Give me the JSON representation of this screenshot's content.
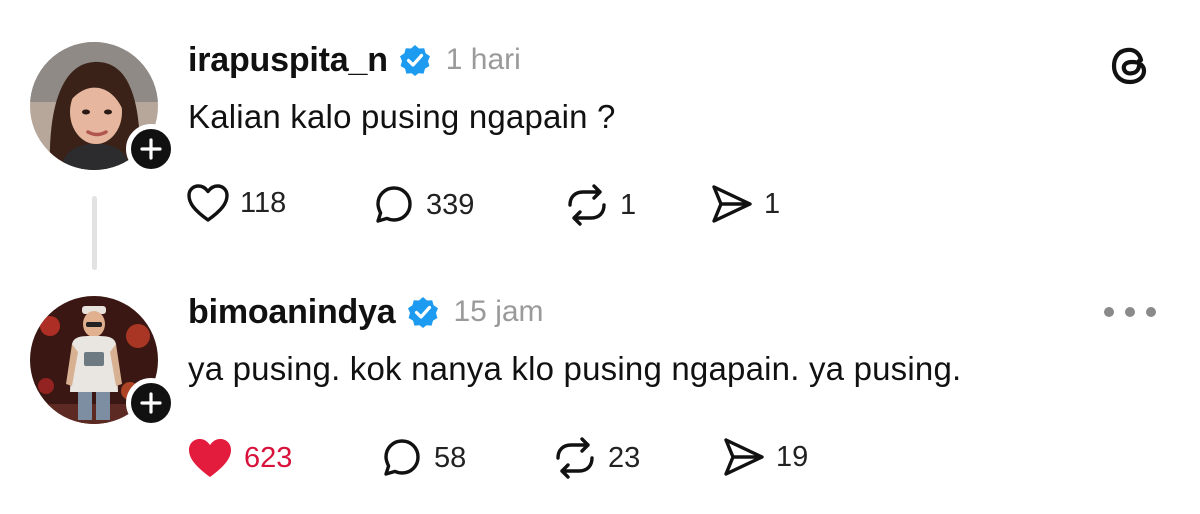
{
  "app": {
    "logo_icon": "threads-logo-icon"
  },
  "colors": {
    "verified": "#1d9bf0",
    "liked": "#e31b3c",
    "muted_text": "#9a9a9a"
  },
  "posts": [
    {
      "username": "irapuspita_n",
      "time": "1 hari",
      "text": "Kalian kalo pusing ngapain ?",
      "verified": true,
      "actions": {
        "likes": "118",
        "replies": "339",
        "reposts": "1",
        "shares": "1"
      },
      "liked": false
    },
    {
      "username": "bimoanindya",
      "time": "15 jam",
      "text": "ya pusing. kok nanya klo pusing ngapain. ya pusing.",
      "verified": true,
      "actions": {
        "likes": "623",
        "replies": "58",
        "reposts": "23",
        "shares": "19"
      },
      "liked": true
    }
  ]
}
